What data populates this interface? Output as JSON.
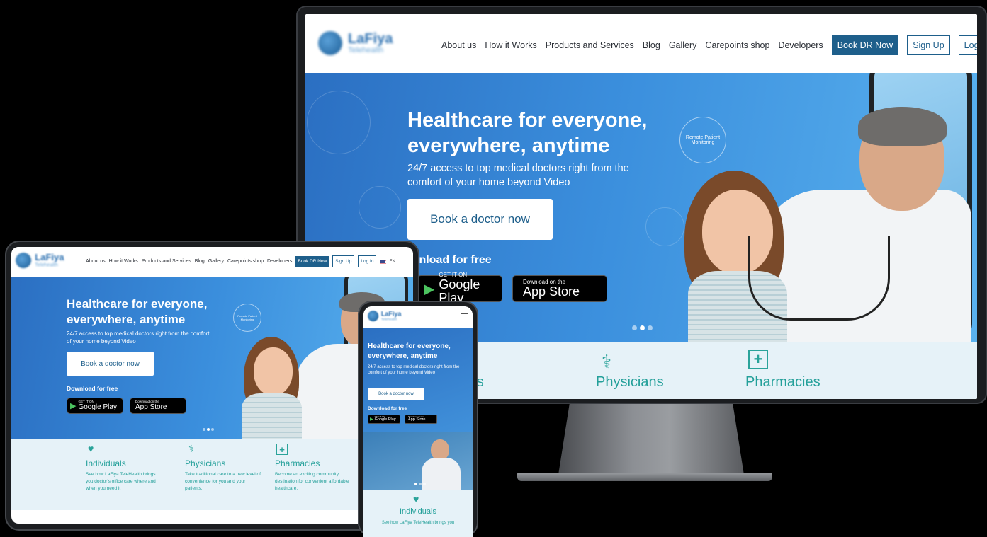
{
  "brand": {
    "name": "LaFiya",
    "sub": "Telehealth"
  },
  "nav": {
    "items": [
      "About us",
      "How it Works",
      "Products and Services",
      "Blog",
      "Gallery",
      "Carepoints shop",
      "Developers"
    ],
    "book_label": "Book DR Now",
    "signup_label": "Sign Up",
    "login_label": "Log In",
    "lang": "EN"
  },
  "hero": {
    "title": "Healthcare for everyone, everywhere, anytime",
    "subtitle": "24/7 access to top medical doctors right from the comfort of your home beyond Video",
    "cta": "Book a doctor now",
    "download": "Download for free",
    "download_partial": "wnload for free",
    "badge": "Remote Patient Monitoring",
    "google_small": "GET IT ON",
    "google_big": "Google Play",
    "apple_small": "Download on the",
    "apple_big": "App Store"
  },
  "features": {
    "individuals": {
      "title": "Individuals",
      "title_partial": "uals",
      "desc": "See how LaFiya TeleHealth brings you doctor's office care where and when you need it"
    },
    "physicians": {
      "title": "Physicians",
      "desc": "Take traditional care to a new level of convenience for you and your patients."
    },
    "pharmacies": {
      "title": "Pharmacies",
      "desc": "Become an exciting community destination for convenient affordable healthcare."
    }
  },
  "phone": {
    "individuals_desc": "See how LaFiya TeleHealth brings you"
  },
  "colors": {
    "primary": "#1e5f8b",
    "accent": "#24a09a",
    "hero_start": "#2b6fc2",
    "hero_end": "#5ab2ef"
  }
}
